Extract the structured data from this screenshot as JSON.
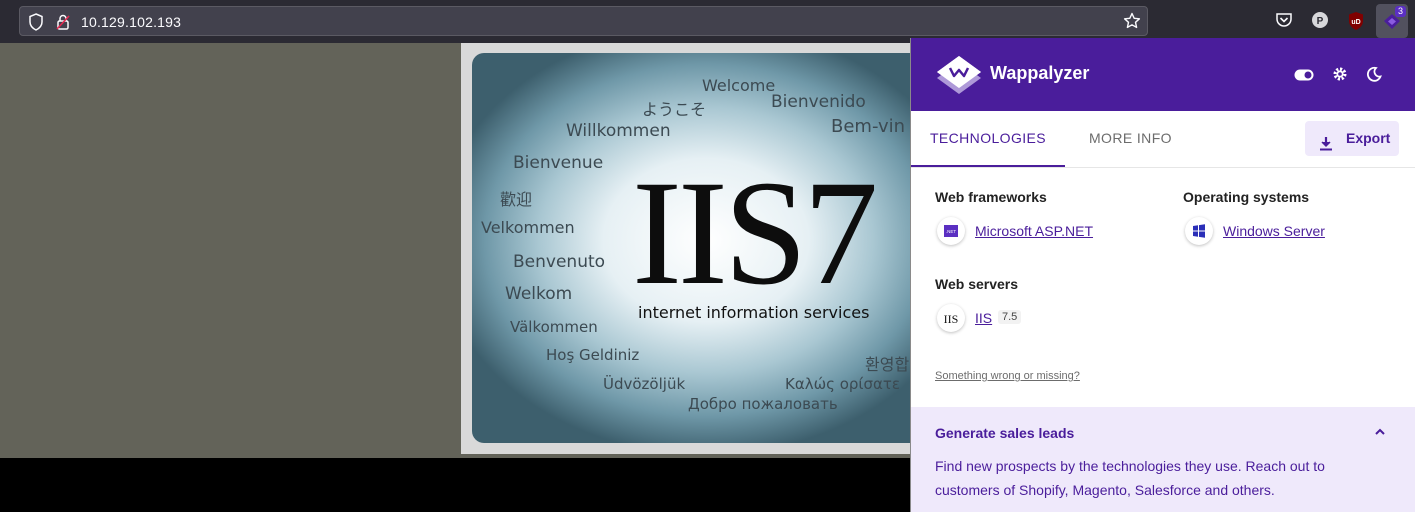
{
  "browser": {
    "url": "10.129.102.193",
    "extension_badge_count": "3"
  },
  "iis_page": {
    "logo_text": "IIS7",
    "subtitle": "internet information services",
    "greetings": [
      "Welcome",
      "ようこそ",
      "Bienvenido",
      "Willkommen",
      "Bem-vin",
      "Bienvenue",
      "歡迎",
      "Velkommen",
      "Benvenuto",
      "Welkom",
      "Välkommen",
      "Hoş Geldiniz",
      "환영합",
      "Üdvözöljük",
      "Καλώς ορίσατε",
      "Добро пожаловать"
    ]
  },
  "wappalyzer": {
    "brand": "Wappalyzer",
    "tabs": [
      {
        "label": "TECHNOLOGIES",
        "active": true
      },
      {
        "label": "MORE INFO",
        "active": false
      }
    ],
    "export_label": "Export",
    "categories": [
      {
        "name": "Web frameworks",
        "items": [
          {
            "name": "Microsoft ASP.NET",
            "icon": ".NET-icon"
          }
        ]
      },
      {
        "name": "Operating systems",
        "items": [
          {
            "name": "Windows Server",
            "icon": "windows-icon"
          }
        ]
      },
      {
        "name": "Web servers",
        "items": [
          {
            "name": "IIS",
            "version": "7.5",
            "icon": "IIS-icon"
          }
        ]
      }
    ],
    "feedback_link": "Something wrong or missing?",
    "leads": {
      "title": "Generate sales leads",
      "text": "Find new prospects by the technologies they use. Reach out to customers of Shopify, Magento, Salesforce and others."
    },
    "accent_color": "#4a1d9b"
  }
}
